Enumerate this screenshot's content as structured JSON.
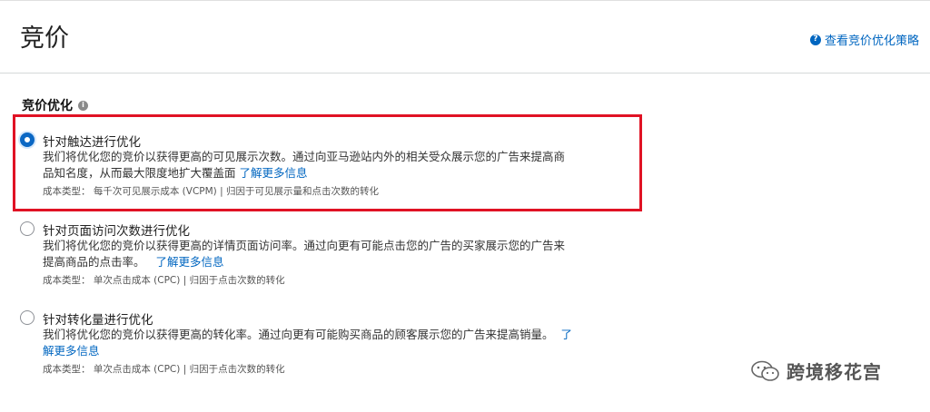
{
  "header": {
    "title": "竞价",
    "help_link": "查看竞价优化策略",
    "help_icon_glyph": "?"
  },
  "section": {
    "title": "竞价优化",
    "info_icon_glyph": "i"
  },
  "options": [
    {
      "title": "针对触达进行优化",
      "selected": true,
      "desc_line1": "我们将优化您的竞价以获得更高的可见展示次数。通过向亚马逊站内外的相关受众展示您的广告来提高商",
      "desc_line2": "品知名度，从而最大限度地扩大覆盖面",
      "learn_more": "了解更多信息",
      "cost": "成本类型： 每千次可见展示成本 (VCPM) | 归因于可见展示量和点击次数的转化"
    },
    {
      "title": "针对页面访问次数进行优化",
      "selected": false,
      "desc_line1": "我们将优化您的竞价以获得更高的详情页面访问率。通过向更有可能点击您的广告的买家展示您的广告来",
      "desc_line2": "提高商品的点击率。",
      "learn_more": "了解更多信息",
      "cost": "成本类型： 单次点击成本 (CPC) | 归因于点击次数的转化"
    },
    {
      "title": "针对转化量进行优化",
      "selected": false,
      "desc_line1": "我们将优化您的竞价以获得更高的转化率。通过向更有可能购买商品的顾客展示您的广告来提高销量。",
      "learn_more_a": "了",
      "learn_more_b": "解更多信息",
      "cost": "成本类型： 单次点击成本 (CPC) | 归因于点击次数的转化"
    }
  ],
  "watermark": {
    "text": "跨境移花宫"
  },
  "colors": {
    "accent": "#0066c0",
    "highlight": "#e01224"
  }
}
